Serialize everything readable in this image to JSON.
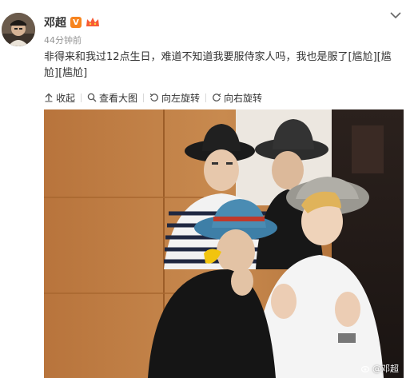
{
  "post": {
    "username": "邓超",
    "verified_badge": "V",
    "time": "44分钟前",
    "text": "非得来和我过12点生日，难道不知道我要服侍家人吗，我也是服了[尴尬][尴尬][尴尬]"
  },
  "toolbar": {
    "collapse": "收起",
    "view_large": "查看大图",
    "rotate_left": "向左旋转",
    "rotate_right": "向右旋转"
  },
  "photo": {
    "watermark": "@邓超"
  },
  "icons": {
    "chevron": "chevron-down-icon",
    "member": "crown-member-icon"
  },
  "colors": {
    "badge": "#f7841e",
    "muted": "#939393"
  }
}
